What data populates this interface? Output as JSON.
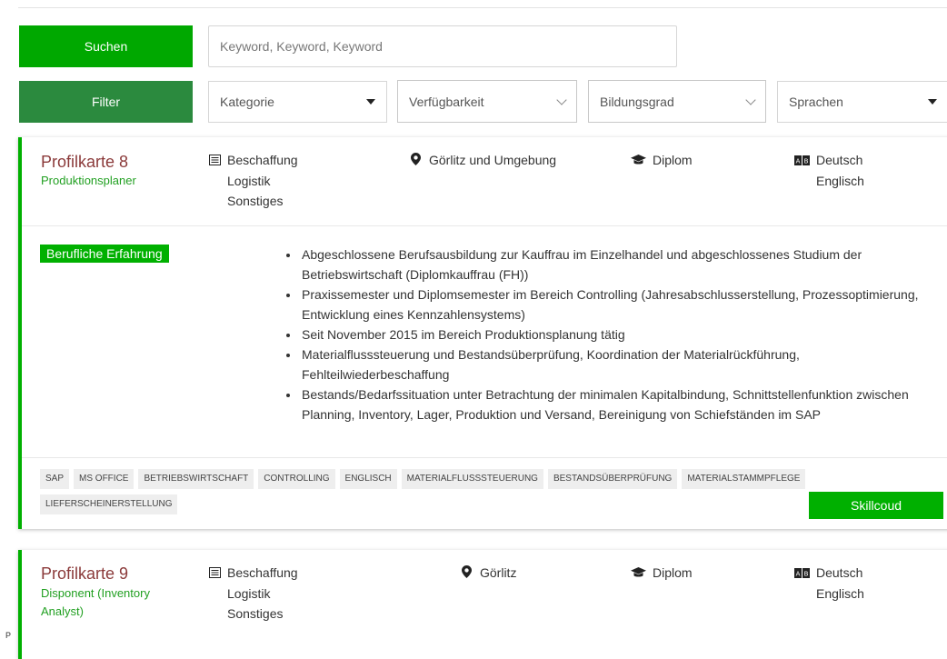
{
  "search": {
    "button_label": "Suchen",
    "placeholder": "Keyword, Keyword, Keyword",
    "value": ""
  },
  "filter": {
    "button_label": "Filter",
    "selects": [
      {
        "label": "Kategorie"
      },
      {
        "label": "Verfügbarkeit"
      },
      {
        "label": "Bildungsgrad"
      },
      {
        "label": "Sprachen"
      }
    ]
  },
  "cards": [
    {
      "title": "Profilkarte 8",
      "subtitle": "Produktionsplaner",
      "categories": [
        "Beschaffung",
        "Logistik",
        "Sonstiges"
      ],
      "location": "Görlitz und Umgebung",
      "education": "Diplom",
      "languages": [
        "Deutsch",
        "Englisch"
      ],
      "experience_label": "Berufliche Erfahrung",
      "experience": [
        "Abgeschlossene Berufsausbildung zur Kauffrau im Einzelhandel und abgeschlossenes Studium der Betriebswirtschaft (Diplomkauffrau (FH))",
        "Praxissemester und Diplomsemester im Bereich Controlling (Jahresabschlusserstellung, Prozessoptimierung, Entwicklung eines Kennzahlensystems)",
        "Seit November 2015 im Bereich Produktionsplanung tätig",
        "Materialflusssteuerung und Bestandsüberprüfung, Koordination der Materialrückführung, Fehlteilwiederbeschaffung",
        "Bestands/Bedarfssituation unter Betrachtung der minimalen Kapitalbindung, Schnittstellenfunktion zwischen Planning, Inventory, Lager, Produktion und Versand, Bereinigung von Schiefständen im SAP"
      ],
      "tags": [
        "SAP",
        "MS OFFICE",
        "BETRIEBSWIRTSCHAFT",
        "CONTROLLING",
        "ENGLISCH",
        "MATERIALFLUSSSTEUERUNG",
        "BESTANDSÜBERPRÜFUNG",
        "MATERIALSTAMMPFLEGE",
        "LIEFERSCHEINERSTELLUNG"
      ],
      "action_label": "Skillcoud"
    },
    {
      "title": "Profilkarte 9",
      "subtitle": "Disponent (Inventory Analyst)",
      "categories": [
        "Beschaffung",
        "Logistik",
        "Sonstiges"
      ],
      "location": "Görlitz",
      "education": "Diplom",
      "languages": [
        "Deutsch",
        "Englisch"
      ]
    }
  ],
  "stray_text": "P",
  "icons": {
    "category": "list-icon",
    "location": "map-marker-icon",
    "education": "graduation-cap-icon",
    "language": "language-icon"
  },
  "colors": {
    "primary_green": "#00a800",
    "dark_green": "#2b8a3e",
    "title_red": "#8b3a3a",
    "subtitle_green": "#22a022"
  }
}
